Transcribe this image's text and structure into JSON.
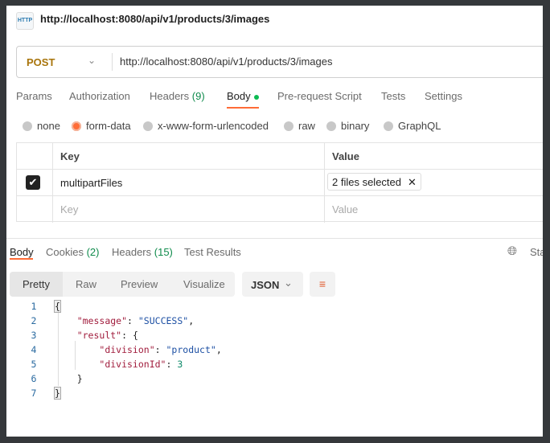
{
  "header": {
    "icon": "HTTP",
    "title": "http://localhost:8080/api/v1/products/3/images"
  },
  "request": {
    "method": "POST",
    "url": "http://localhost:8080/api/v1/products/3/images"
  },
  "tabs": [
    {
      "label": "Params"
    },
    {
      "label": "Authorization"
    },
    {
      "label": "Headers",
      "count": "(9)"
    },
    {
      "label": "Body"
    },
    {
      "label": "Pre-request Script"
    },
    {
      "label": "Tests"
    },
    {
      "label": "Settings"
    }
  ],
  "body_types": [
    {
      "label": "none"
    },
    {
      "label": "form-data",
      "selected": true
    },
    {
      "label": "x-www-form-urlencoded"
    },
    {
      "label": "raw"
    },
    {
      "label": "binary"
    },
    {
      "label": "GraphQL"
    }
  ],
  "form": {
    "headers": {
      "key": "Key",
      "value": "Value"
    },
    "rows": [
      {
        "checked": true,
        "key": "multipartFiles",
        "value": "2 files selected"
      }
    ],
    "placeholder": {
      "key": "Key",
      "value": "Value"
    }
  },
  "response": {
    "tabs": [
      {
        "label": "Body"
      },
      {
        "label": "Cookies",
        "count": "(2)"
      },
      {
        "label": "Headers",
        "count": "(15)"
      },
      {
        "label": "Test Results"
      }
    ],
    "status_partial": "Sta",
    "views": [
      "Pretty",
      "Raw",
      "Preview",
      "Visualize"
    ],
    "format": "JSON",
    "lines": [
      "1",
      "2",
      "3",
      "4",
      "5",
      "6",
      "7"
    ],
    "code": {
      "open": "{",
      "k1": "\"message\"",
      "v1": "\"SUCCESS\"",
      "k2": "\"result\"",
      "k3": "\"division\"",
      "v3": "\"product\"",
      "k4": "\"divisionId\"",
      "v4": "3",
      "close_inner": "}",
      "close": "}"
    }
  },
  "colors": {
    "accent": "#ff6c37",
    "method": "#a8740b"
  }
}
